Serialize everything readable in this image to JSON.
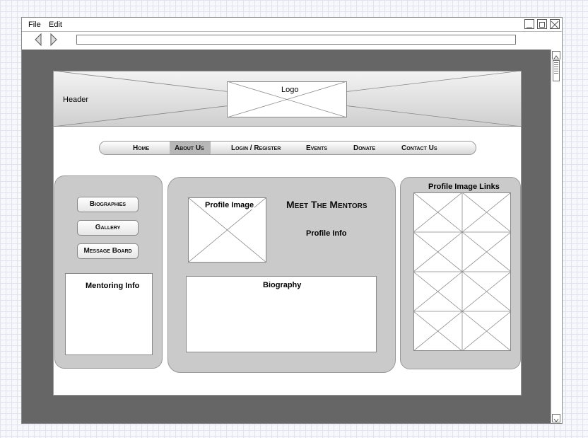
{
  "menu": {
    "file": "File",
    "edit": "Edit"
  },
  "header": {
    "label": "Header",
    "logo": "Logo"
  },
  "nav": {
    "items": [
      "Home",
      "About Us",
      "Login / Register",
      "Events",
      "Donate",
      "Contact Us"
    ],
    "active": "About Us"
  },
  "left": {
    "buttons": [
      "Biographies",
      "Gallery",
      "Message Board"
    ],
    "info": "Mentoring Info"
  },
  "main": {
    "profile_image": "Profile Image",
    "title": "Meet The Mentors",
    "profile_info": "Profile Info",
    "biography": "Biography"
  },
  "right": {
    "title": "Profile Image Links"
  }
}
